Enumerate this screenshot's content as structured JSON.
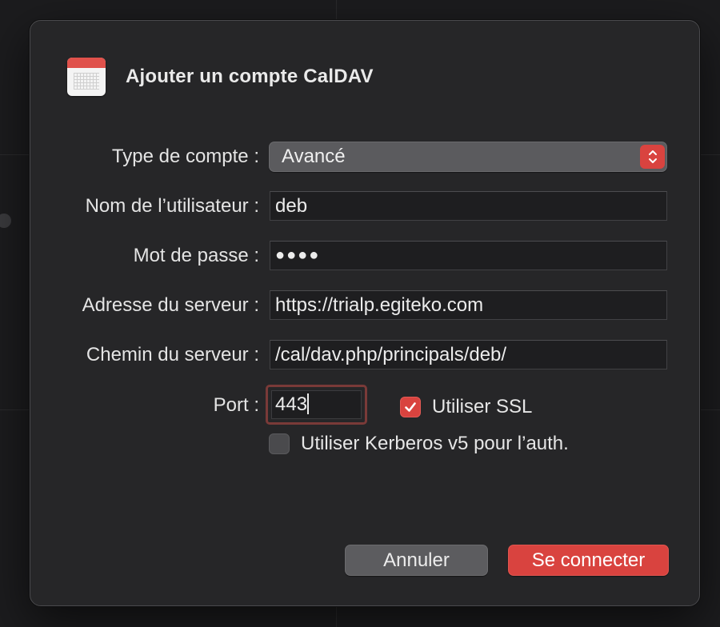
{
  "dialog": {
    "title": "Ajouter un compte CalDAV",
    "icon": "calendar-icon"
  },
  "form": {
    "account_type": {
      "label": "Type de compte :",
      "value": "Avancé"
    },
    "username": {
      "label": "Nom de l’utilisateur :",
      "value": "deb"
    },
    "password": {
      "label": "Mot de passe :",
      "value": "●●●●"
    },
    "server_address": {
      "label": "Adresse du serveur :",
      "value": "https://trialp.egiteko.com"
    },
    "server_path": {
      "label": "Chemin du serveur :",
      "value": "/cal/dav.php/principals/deb/"
    },
    "port": {
      "label": "Port :",
      "value": "443"
    },
    "use_ssl": {
      "label": "Utiliser SSL",
      "checked": true
    },
    "use_kerberos": {
      "label": "Utiliser Kerberos v5 pour l’auth.",
      "checked": false
    }
  },
  "buttons": {
    "cancel": "Annuler",
    "connect": "Se connecter"
  },
  "colors": {
    "accent": "#d9433f",
    "sheet_bg": "#262628",
    "field_bg": "#1e1e20"
  }
}
